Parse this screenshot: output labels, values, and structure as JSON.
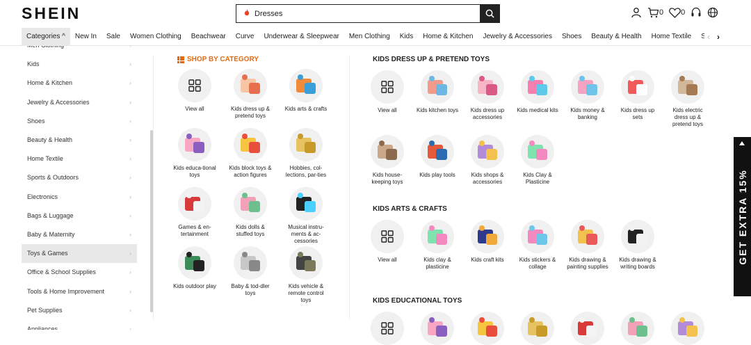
{
  "header": {
    "logo": "SHEIN",
    "search_value": "Dresses",
    "cart_count": "0",
    "wishlist_count": "0"
  },
  "nav": {
    "items": [
      "Categories ^",
      "New In",
      "Sale",
      "Women Clothing",
      "Beachwear",
      "Curve",
      "Underwear & Sleepwear",
      "Men Clothing",
      "Kids",
      "Home & Kitchen",
      "Jewelry & Accessories",
      "Shoes",
      "Beauty & Health",
      "Home Textile",
      "Sport"
    ],
    "prev": "‹",
    "next": "›"
  },
  "sidebar": {
    "items": [
      "Men Clothing",
      "Kids",
      "Home & Kitchen",
      "Jewelry & Accessories",
      "Shoes",
      "Beauty & Health",
      "Home Textile",
      "Sports & Outdoors",
      "Electronics",
      "Bags & Luggage",
      "Baby & Maternity",
      "Toys & Games",
      "Office & School Supplies",
      "Tools & Home Improvement",
      "Pet Supplies",
      "Appliances"
    ],
    "active": "Toys & Games"
  },
  "shop_by_category": {
    "title": "SHOP BY CATEGORY",
    "items": [
      {
        "label": "View all",
        "icon": "grid-icon"
      },
      {
        "label": "Kids dress up & pretend toys",
        "icon": "pretend-toys-icon"
      },
      {
        "label": "Kids arts & crafts",
        "icon": "arts-crafts-icon"
      },
      {
        "label": "Kids educa-tional toys",
        "icon": "educational-toys-icon"
      },
      {
        "label": "Kids block toys & action figures",
        "icon": "block-toys-icon"
      },
      {
        "label": "Hobbies, col-lections, par-ties",
        "icon": "hobbies-icon"
      },
      {
        "label": "Games & en-tertainment",
        "icon": "games-icon"
      },
      {
        "label": "Kids dolls & stuffed toys",
        "icon": "dolls-icon"
      },
      {
        "label": "Musical instru-ments & ac-cessories",
        "icon": "speaker-icon"
      },
      {
        "label": "Kids outdoor play",
        "icon": "toy-gun-icon"
      },
      {
        "label": "Baby & tod-dler toys",
        "icon": "baby-toys-icon"
      },
      {
        "label": "Kids vehicle & remote control toys",
        "icon": "tank-icon"
      }
    ]
  },
  "sections": [
    {
      "title": "KIDS DRESS UP & PRETEND TOYS",
      "items": [
        {
          "label": "View all",
          "icon": "grid-icon"
        },
        {
          "label": "Kids kitchen toys",
          "icon": "kitchen-toys-icon"
        },
        {
          "label": "Kids dress up accessories",
          "icon": "dress-up-acc-icon"
        },
        {
          "label": "Kids medical kits",
          "icon": "medical-kit-icon"
        },
        {
          "label": "Kids money & banking",
          "icon": "cash-register-icon"
        },
        {
          "label": "Kids dress up sets",
          "icon": "dress-up-set-icon"
        },
        {
          "label": "Kids electric dress up & pretend toys",
          "icon": "electric-toys-icon"
        },
        {
          "label": "Kids house-keeping toys",
          "icon": "housekeeping-icon"
        },
        {
          "label": "Kids play tools",
          "icon": "play-tools-icon"
        },
        {
          "label": "Kids shops & accessories",
          "icon": "shop-toys-icon"
        },
        {
          "label": "Kids Clay & Plasticine",
          "icon": "clay-icon"
        }
      ]
    },
    {
      "title": "KIDS ARTS & CRAFTS",
      "items": [
        {
          "label": "View all",
          "icon": "grid-icon"
        },
        {
          "label": "Kids clay & plasticine",
          "icon": "clay-icon"
        },
        {
          "label": "Kids craft kits",
          "icon": "craft-kit-icon"
        },
        {
          "label": "Kids stickers & collage",
          "icon": "stickers-icon"
        },
        {
          "label": "Kids drawing & painting supplies",
          "icon": "painting-icon"
        },
        {
          "label": "Kids drawing & writing boards",
          "icon": "drawing-board-icon"
        }
      ]
    },
    {
      "title": "KIDS EDUCATIONAL TOYS",
      "items": []
    }
  ],
  "promo": {
    "text": "GET EXTRA 15%"
  },
  "colors": {
    "accent": "#e36a12",
    "dark": "#222222",
    "circle_bg": "#f0f0f0"
  }
}
